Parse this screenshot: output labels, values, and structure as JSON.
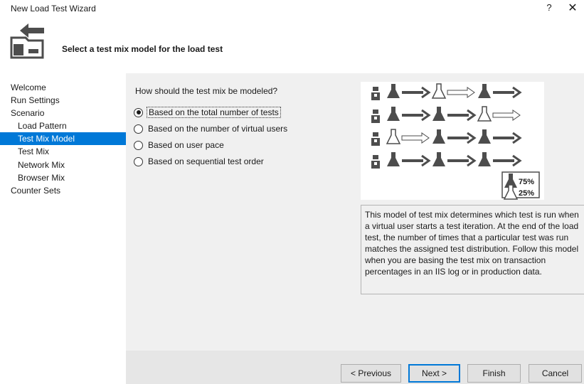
{
  "window": {
    "title": "New Load Test Wizard",
    "help_label": "?",
    "close_label": "✕"
  },
  "header": {
    "title": "Select a test mix model for the load test",
    "icon": "wizard-folder-arrow-icon"
  },
  "nav": {
    "items": [
      {
        "label": "Welcome",
        "level": 0,
        "selected": false
      },
      {
        "label": "Run Settings",
        "level": 0,
        "selected": false
      },
      {
        "label": "Scenario",
        "level": 0,
        "selected": false
      },
      {
        "label": "Load Pattern",
        "level": 1,
        "selected": false
      },
      {
        "label": "Test Mix Model",
        "level": 1,
        "selected": true
      },
      {
        "label": "Test Mix",
        "level": 1,
        "selected": false
      },
      {
        "label": "Network Mix",
        "level": 1,
        "selected": false
      },
      {
        "label": "Browser Mix",
        "level": 1,
        "selected": false
      },
      {
        "label": "Counter Sets",
        "level": 0,
        "selected": false
      }
    ]
  },
  "main": {
    "question": "How should the test mix be modeled?",
    "options": [
      {
        "label": "Based on the total number of tests",
        "checked": true
      },
      {
        "label": "Based on the number of virtual users",
        "checked": false
      },
      {
        "label": "Based on user pace",
        "checked": false
      },
      {
        "label": "Based on sequential test order",
        "checked": false
      }
    ],
    "illustration": {
      "legend_dark": "75%",
      "legend_light": "25%"
    },
    "description": "This model of test mix determines which test is run when a virtual user starts a test iteration. At the end of the load test, the number of times that a particular test was run matches the assigned test distribution. Follow this model when you are basing the test mix on transaction percentages in an IIS log or in production data."
  },
  "footer": {
    "previous_label": "< Previous",
    "next_label": "Next >",
    "finish_label": "Finish",
    "cancel_label": "Cancel"
  },
  "colors": {
    "selection": "#0078d7",
    "content_bg": "#f0f0f0",
    "icon_dark": "#4d4d4d"
  }
}
